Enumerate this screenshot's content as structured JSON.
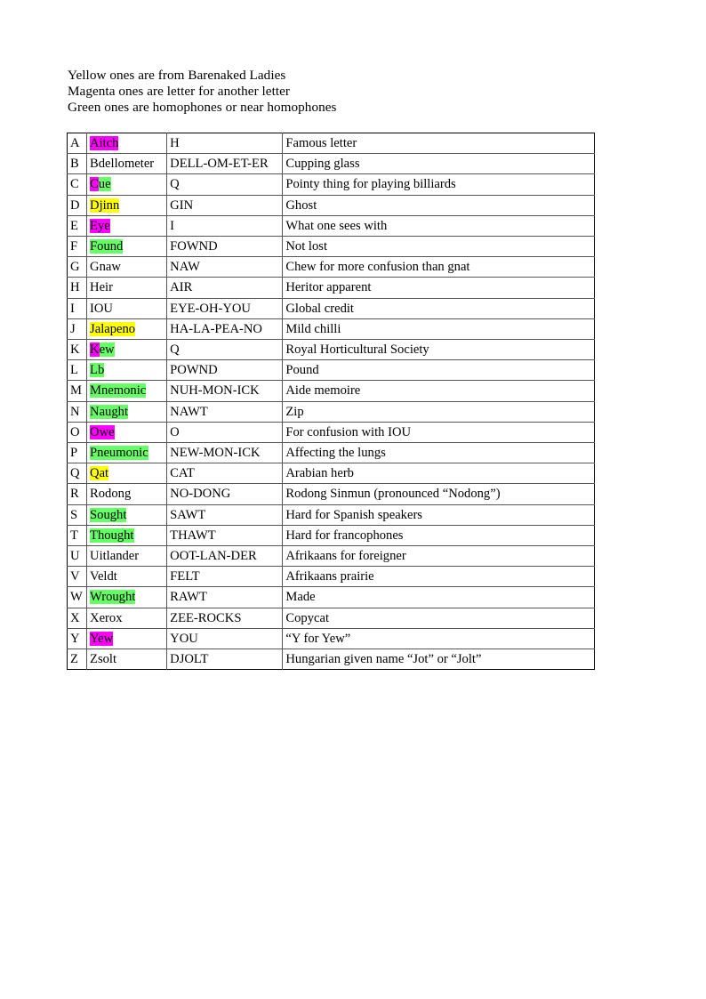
{
  "legend": {
    "lines": [
      "Yellow ones are from Barenaked Ladies",
      "Magenta ones are letter for another letter",
      "Green ones are homophones or near homophones"
    ]
  },
  "colors": {
    "yellow": "#ffff00",
    "magenta": "#ff00ff",
    "green": "#66ff66",
    "text": "#000000",
    "border_outer": "#000000",
    "border_inner": "#555555",
    "page_background": "#ffffff"
  },
  "table": {
    "columns": [
      "letter",
      "word",
      "pronunciation",
      "description"
    ],
    "rows": [
      {
        "letter": "A",
        "word": "Aitch",
        "word_segments": [
          {
            "text": "Aitch",
            "highlight": "magenta"
          },
          {
            "text": " ",
            "highlight": "green"
          }
        ],
        "pronunciation": "H",
        "description": "Famous letter"
      },
      {
        "letter": "B",
        "word": "Bdellometer",
        "word_segments": [
          {
            "text": "Bdellometer",
            "highlight": "none"
          }
        ],
        "pronunciation": "DELL-OM-ET-ER",
        "description": "Cupping glass"
      },
      {
        "letter": "C",
        "word": "Cue",
        "word_segments": [
          {
            "text": "C",
            "highlight": "magenta"
          },
          {
            "text": "ue",
            "highlight": "green"
          }
        ],
        "pronunciation": "Q",
        "description": "Pointy thing for playing billiards"
      },
      {
        "letter": "D",
        "word": "Djinn",
        "word_segments": [
          {
            "text": "Djinn",
            "highlight": "yellow"
          }
        ],
        "pronunciation": "GIN",
        "description": "Ghost"
      },
      {
        "letter": "E",
        "word": "Eye",
        "word_segments": [
          {
            "text": "Eye",
            "highlight": "magenta"
          },
          {
            "text": " ",
            "highlight": "green"
          }
        ],
        "pronunciation": "I",
        "description": "What one sees with"
      },
      {
        "letter": "F",
        "word": "Found",
        "word_segments": [
          {
            "text": "Found",
            "highlight": "green"
          }
        ],
        "pronunciation": "FOWND",
        "description": "Not lost"
      },
      {
        "letter": "G",
        "word": "Gnaw",
        "word_segments": [
          {
            "text": "Gnaw",
            "highlight": "none"
          }
        ],
        "pronunciation": "NAW",
        "description": "Chew for more confusion than gnat"
      },
      {
        "letter": "H",
        "word": "Heir",
        "word_segments": [
          {
            "text": "Heir",
            "highlight": "none"
          }
        ],
        "pronunciation": "AIR",
        "description": "Heritor apparent"
      },
      {
        "letter": "I",
        "word": "IOU",
        "word_segments": [
          {
            "text": "IOU",
            "highlight": "none"
          }
        ],
        "pronunciation": "EYE-OH-YOU",
        "description": "Global credit"
      },
      {
        "letter": "J",
        "word": "Jalapeno",
        "word_segments": [
          {
            "text": "Jalapeno",
            "highlight": "yellow"
          }
        ],
        "pronunciation": "HA-LA-PEA-NO",
        "description": "Mild chilli"
      },
      {
        "letter": "K",
        "word": "Kew",
        "word_segments": [
          {
            "text": "K",
            "highlight": "magenta"
          },
          {
            "text": "ew",
            "highlight": "green"
          }
        ],
        "pronunciation": "Q",
        "description": "Royal Horticultural Society"
      },
      {
        "letter": "L",
        "word": "Lb",
        "word_segments": [
          {
            "text": "Lb",
            "highlight": "green"
          }
        ],
        "pronunciation": "POWND",
        "description": "Pound"
      },
      {
        "letter": "M",
        "word": "Mnemonic",
        "word_segments": [
          {
            "text": "Mnemonic",
            "highlight": "green"
          }
        ],
        "pronunciation": "NUH-MON-ICK",
        "description": "Aide memoire"
      },
      {
        "letter": "N",
        "word": "Naught",
        "word_segments": [
          {
            "text": "Naught",
            "highlight": "green"
          }
        ],
        "pronunciation": "NAWT",
        "description": "Zip"
      },
      {
        "letter": "O",
        "word": "Owe",
        "word_segments": [
          {
            "text": "Owe",
            "highlight": "magenta"
          },
          {
            "text": " ",
            "highlight": "green"
          }
        ],
        "pronunciation": "O",
        "description": "For confusion with IOU"
      },
      {
        "letter": "P",
        "word": "Pneumonic",
        "word_segments": [
          {
            "text": "Pneumonic",
            "highlight": "green"
          }
        ],
        "pronunciation": "NEW-MON-ICK",
        "description": "Affecting the lungs"
      },
      {
        "letter": "Q",
        "word": "Qat",
        "word_segments": [
          {
            "text": "Qat",
            "highlight": "yellow"
          }
        ],
        "pronunciation": "CAT",
        "description": "Arabian herb"
      },
      {
        "letter": "R",
        "word": "Rodong",
        "word_segments": [
          {
            "text": "Rodong",
            "highlight": "none"
          }
        ],
        "pronunciation": "NO-DONG",
        "description": "Rodong Sinmun (pronounced “Nodong”)"
      },
      {
        "letter": "S",
        "word": "Sought",
        "word_segments": [
          {
            "text": "Sought",
            "highlight": "green"
          }
        ],
        "pronunciation": "SAWT",
        "description": "Hard for Spanish speakers"
      },
      {
        "letter": "T",
        "word": "Thought",
        "word_segments": [
          {
            "text": "Thought",
            "highlight": "green"
          }
        ],
        "pronunciation": "THAWT",
        "description": "Hard for francophones"
      },
      {
        "letter": "U",
        "word": "Uitlander",
        "word_segments": [
          {
            "text": "Uitlander",
            "highlight": "none"
          }
        ],
        "pronunciation": "OOT-LAN-DER",
        "description": "Afrikaans for foreigner"
      },
      {
        "letter": "V",
        "word": "Veldt",
        "word_segments": [
          {
            "text": "Veldt",
            "highlight": "none"
          }
        ],
        "pronunciation": "FELT",
        "description": "Afrikaans prairie"
      },
      {
        "letter": "W",
        "word": "Wrought",
        "word_segments": [
          {
            "text": "Wrought",
            "highlight": "green"
          }
        ],
        "pronunciation": "RAWT",
        "description": "Made"
      },
      {
        "letter": "X",
        "word": "Xerox",
        "word_segments": [
          {
            "text": "Xerox",
            "highlight": "none"
          }
        ],
        "pronunciation": "ZEE-ROCKS",
        "description": "Copycat"
      },
      {
        "letter": "Y",
        "word": "Yew",
        "word_segments": [
          {
            "text": "Yew",
            "highlight": "magenta"
          }
        ],
        "pronunciation": "YOU",
        "description": "“Y for Yew”"
      },
      {
        "letter": "Z",
        "word": "Zsolt",
        "word_segments": [
          {
            "text": "Zsolt",
            "highlight": "none"
          }
        ],
        "pronunciation": "DJOLT",
        "description": "Hungarian given name “Jot” or “Jolt”"
      }
    ]
  }
}
